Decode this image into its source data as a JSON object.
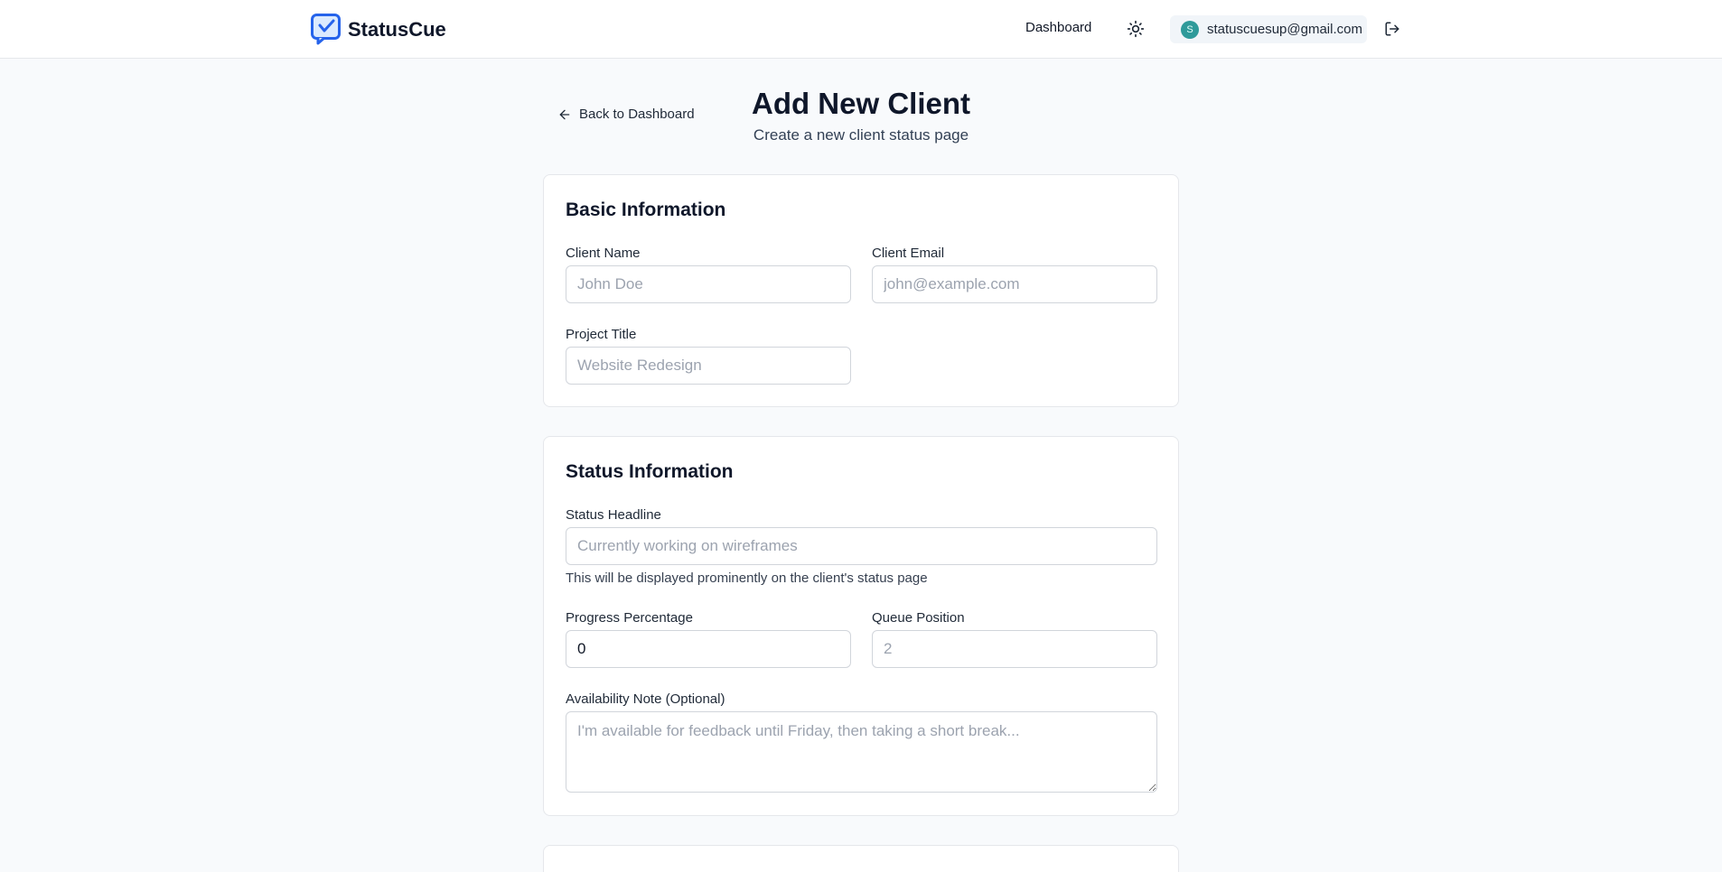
{
  "header": {
    "brand": "StatusCue",
    "nav_dashboard": "Dashboard",
    "user_initial": "S",
    "user_email": "statuscuesup@gmail.com",
    "accent": "#2563eb",
    "avatar_color": "#2f9a9a"
  },
  "page": {
    "back_label": "Back to Dashboard",
    "title": "Add New Client",
    "subtitle": "Create a new client status page"
  },
  "basic": {
    "title": "Basic Information",
    "client_name_label": "Client Name",
    "client_name_placeholder": "John Doe",
    "client_email_label": "Client Email",
    "client_email_placeholder": "john@example.com",
    "project_title_label": "Project Title",
    "project_title_placeholder": "Website Redesign"
  },
  "status": {
    "title": "Status Information",
    "headline_label": "Status Headline",
    "headline_placeholder": "Currently working on wireframes",
    "headline_help": "This will be displayed prominently on the client's status page",
    "progress_label": "Progress Percentage",
    "progress_value": "0",
    "queue_label": "Queue Position",
    "queue_placeholder": "2",
    "availability_label": "Availability Note (Optional)",
    "availability_placeholder": "I'm available for feedback until Friday, then taking a short break..."
  },
  "icons": {
    "logo": "chat-bubble-check-icon",
    "theme": "sun-icon",
    "logout": "logout-icon",
    "back": "arrow-left-icon"
  }
}
